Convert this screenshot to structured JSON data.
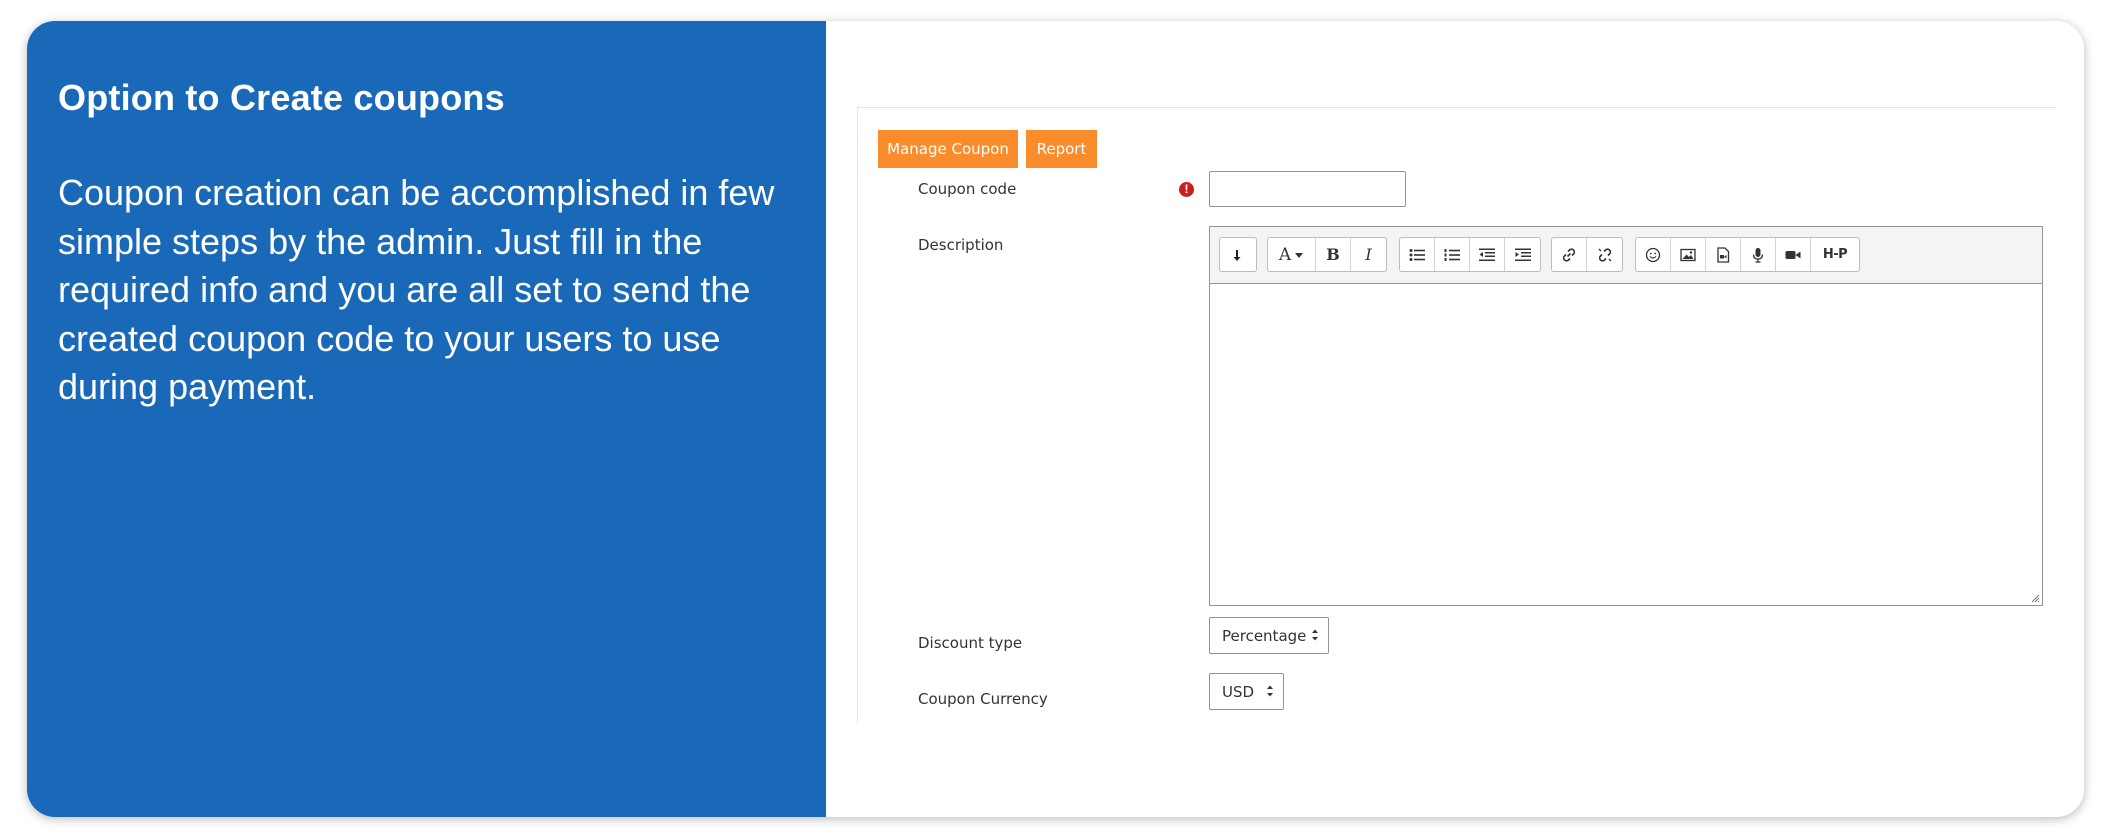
{
  "panel": {
    "title": "Option to Create coupons",
    "description": "Coupon creation can be accomplished in few simple steps by the admin. Just fill in the required info and you are all set to send the created coupon code to your users to use during payment."
  },
  "tabs": {
    "manage": "Manage Coupon",
    "report": "Report"
  },
  "form": {
    "coupon_code_label": "Coupon code",
    "coupon_code_value": "",
    "description_label": "Description",
    "discount_type_label": "Discount type",
    "discount_type_value": "Percentage",
    "currency_label": "Coupon Currency",
    "currency_value": "USD",
    "required_mark": "!"
  },
  "toolbar": {
    "font_glyph": "A",
    "bold": "B",
    "italic": "I",
    "h5p": "H-P"
  },
  "colors": {
    "panel_blue": "#1a69b8",
    "tab_orange": "#fb8c2c",
    "required_red": "#cc1e1e"
  }
}
